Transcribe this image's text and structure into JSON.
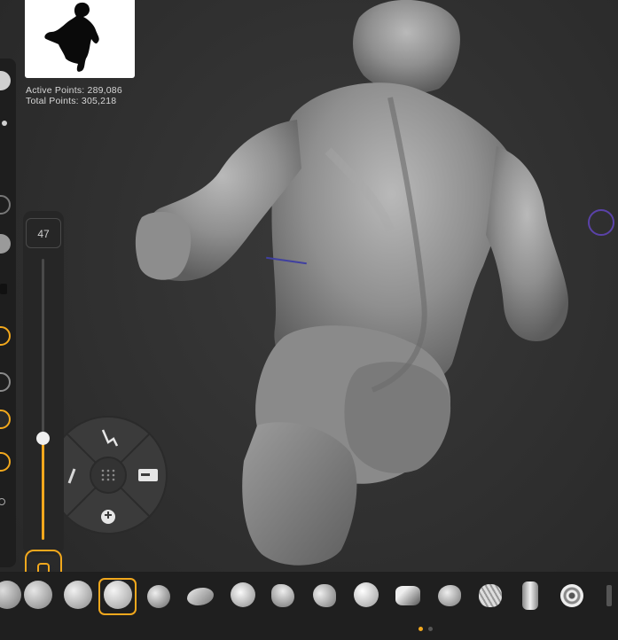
{
  "stats": {
    "active_points": "Active Points: 289,086",
    "total_points": "Total Points: 305,218"
  },
  "brush_size": {
    "value": "47",
    "level": 0.47
  },
  "colors": {
    "accent": "#f2a81d",
    "panel": "#1f1f1f",
    "cursor": "#5a42a8"
  },
  "radial_menu": {
    "items": [
      "hand-gesture-icon",
      "grid-dots-icon",
      "toggle-panel-icon",
      "plus-minus-icon",
      "pencil-icon"
    ]
  },
  "brushes": [
    "sphere-rough-brush-icon",
    "sphere-plain-brush-icon",
    "sphere-smooth-brush-icon",
    "sphere-pinch-brush-icon",
    "clay-stroke-brush-icon",
    "inflate-brush-icon",
    "flatten-brush-icon",
    "trim-brush-icon",
    "standard-brush-icon",
    "crease-brush-icon",
    "polish-brush-icon",
    "layer-brush-icon",
    "pillar-brush-icon",
    "spiral-brush-icon"
  ]
}
